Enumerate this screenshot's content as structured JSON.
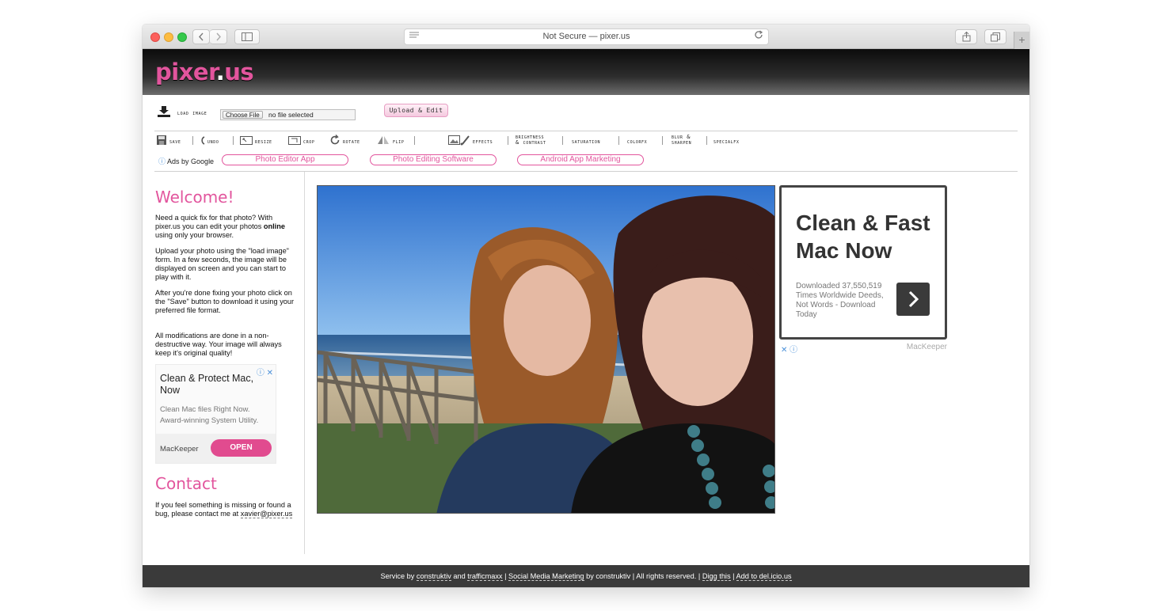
{
  "browser": {
    "address": "Not Secure — pixer.us",
    "reader_icon": "reader-icon",
    "reload_icon": "reload-icon",
    "plus": "+"
  },
  "site": {
    "logo_main": "pixer",
    "logo_dot": ".",
    "logo_tail": "us"
  },
  "load": {
    "label": "load image",
    "choose_file": "Choose File",
    "no_file": "no file selected",
    "upload_button": "Upload & Edit"
  },
  "toolbar": {
    "save": "save",
    "undo": "undo",
    "resize": "resize",
    "crop": "crop",
    "rotate": "rotate",
    "flip": "flip",
    "effects": "effects",
    "brightness_line1": "brightness",
    "brightness_line2": "& contrast",
    "saturation": "saturation",
    "colorfx": "colorfx",
    "blur_line1": "blur &",
    "blur_line2": "sharpen",
    "specialfx": "specialfx"
  },
  "ads_row": {
    "ads_by": "Ads by Google",
    "links": [
      "Photo Editor App",
      "Photo Editing Software",
      "Android App Marketing"
    ]
  },
  "sidebar": {
    "welcome_title": "Welcome!",
    "p1_a": "Need a quick fix for that photo? With pixer.us you can edit your photos ",
    "p1_bold": "online",
    "p1_b": " using only your browser.",
    "p2": "Upload your photo using the \"load image\" form. In a few seconds, the image will be displayed on screen and you can start to play with it.",
    "p3": "After you're done fixing your photo click on the \"Save\" button to download it using your preferred file format.",
    "p4": "All modifications are done in a non-destructive way. Your image will always keep it's original quality!",
    "contact_title": "Contact",
    "contact_text": "If you feel something is missing or found a bug, please contact me at ",
    "email": "xavier@pixer.us"
  },
  "left_ad": {
    "title": "Clean & Protect Mac, Now",
    "desc": "Clean Mac files Right Now. Award-winning System Utility.",
    "brand": "MacKeeper",
    "button": "OPEN",
    "icons": "ⓘ ✕"
  },
  "right_ad": {
    "headline": "Clean & Fast Mac Now",
    "desc": "Downloaded 37,550,519 Times Worldwide Deeds, Not Words - Download Today",
    "brand": "MacKeeper",
    "icons": "✕ ⓘ"
  },
  "footer": {
    "t1": "Service by ",
    "l1": "construktiv",
    "t2": " and ",
    "l2": "trafficmaxx",
    "t3": " | ",
    "l3": "Social Media Marketing",
    "t4": " by construktiv | All rights reserved. | ",
    "l4": "Digg this",
    "t5": " | ",
    "l5": "Add to del.icio.us"
  },
  "colors": {
    "accent": "#e2559d",
    "header_dark": "#0c0c0c",
    "footer_bg": "#3a3a3a"
  }
}
